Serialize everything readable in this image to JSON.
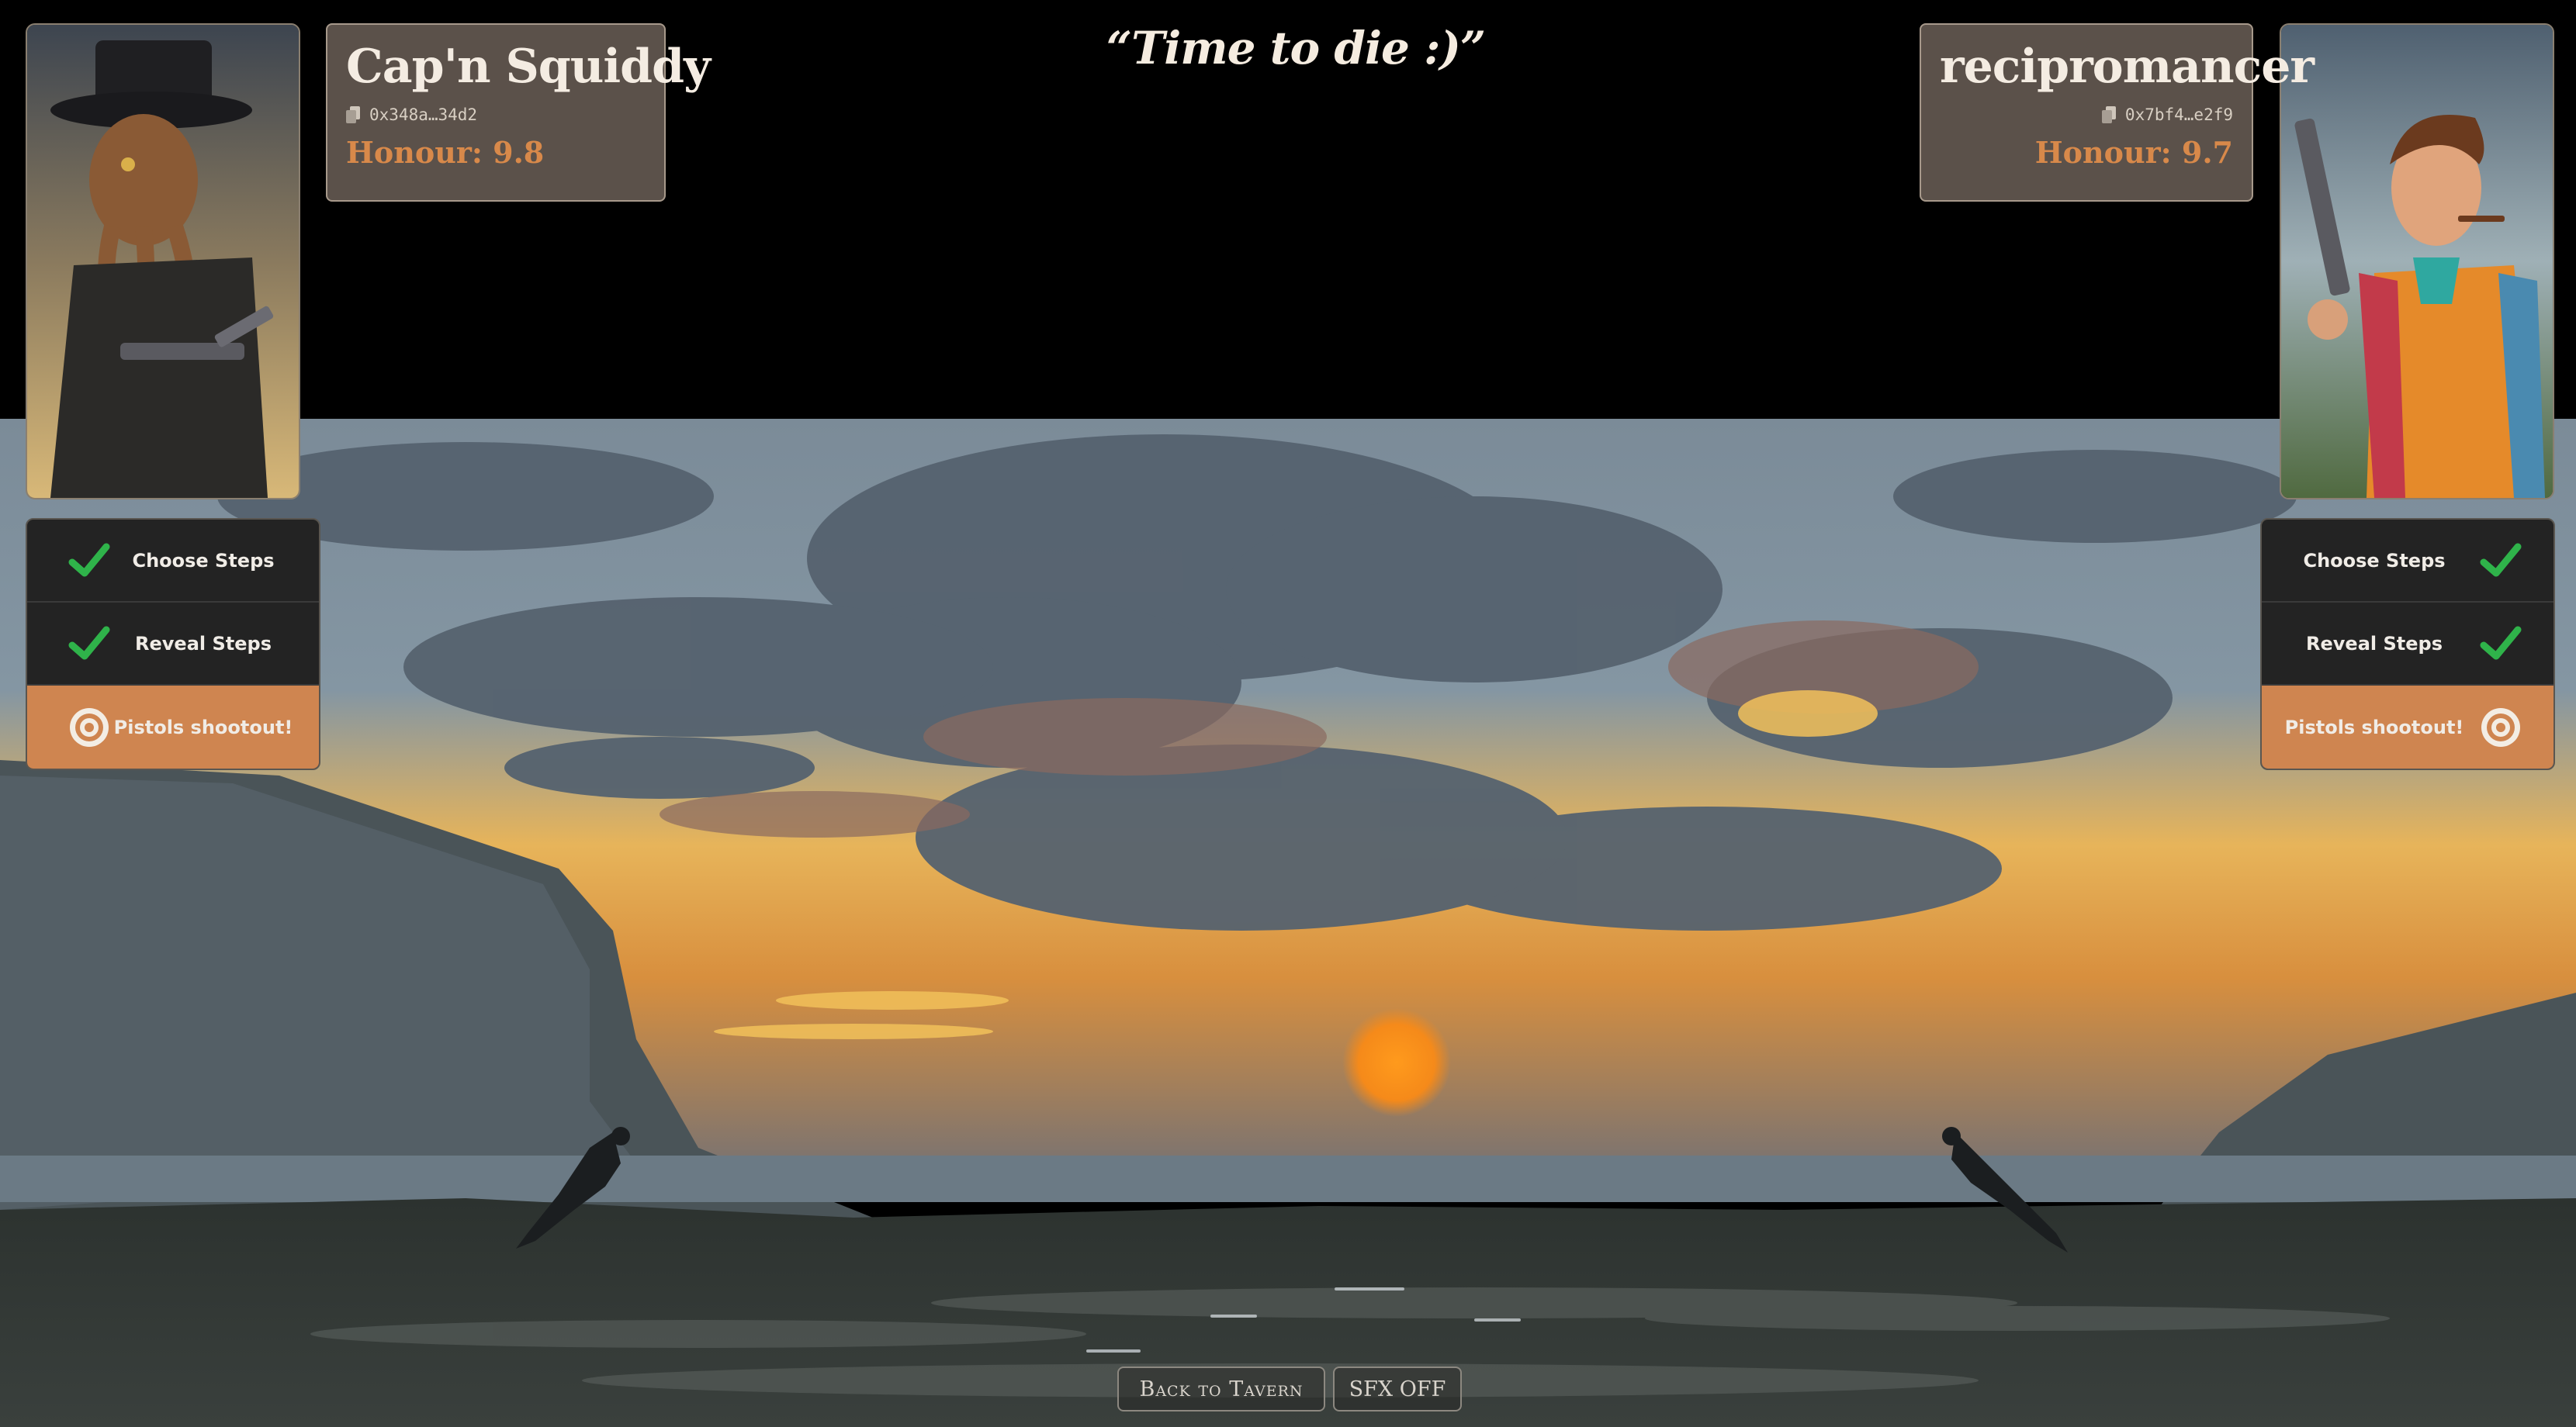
{
  "quote": "“Time to die :)”",
  "player_left": {
    "name": "Cap'n Squiddy",
    "address": "0x348a…34d2",
    "honour": "Honour: 9.8",
    "portrait": "octopus-gunslinger-portrait"
  },
  "player_right": {
    "name": "recipromancer",
    "address": "0x7bf4…e2f9",
    "honour": "Honour: 9.7",
    "portrait": "dandy-duelist-portrait"
  },
  "steps_left": [
    {
      "label": "Choose Steps",
      "icon": "check-icon",
      "state": "done"
    },
    {
      "label": "Reveal Steps",
      "icon": "check-icon",
      "state": "done"
    },
    {
      "label": "Pistols shootout!",
      "icon": "target-icon",
      "state": "active"
    }
  ],
  "steps_right": [
    {
      "label": "Choose Steps",
      "icon": "check-icon",
      "state": "done"
    },
    {
      "label": "Reveal Steps",
      "icon": "check-icon",
      "state": "done"
    },
    {
      "label": "Pistols shootout!",
      "icon": "target-icon",
      "state": "active"
    }
  ],
  "buttons": {
    "back": "Back to Tavern",
    "sfx": "SFX OFF"
  },
  "colors": {
    "accent": "#cf8550",
    "honour": "#d8894a",
    "check": "#2fb34a"
  }
}
